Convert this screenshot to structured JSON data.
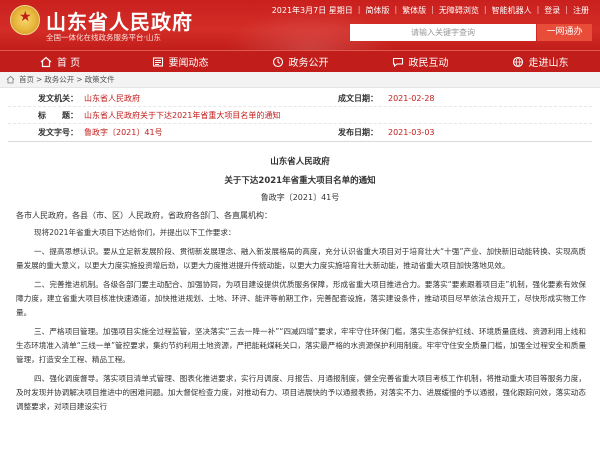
{
  "header": {
    "site_title": "山东省人民政府",
    "site_subtitle": "全国一体化在线政务服务平台·山东",
    "top_links": [
      "2021年3月7日 星期日",
      "简体版",
      "繁体版",
      "无障碍浏览",
      "智能机器人",
      "登录",
      "注册"
    ],
    "search_placeholder": "请输入关键字查询",
    "search_button": "一网通办"
  },
  "nav": [
    {
      "label": "首 页",
      "icon": "home-icon"
    },
    {
      "label": "要闻动态",
      "icon": "news-icon"
    },
    {
      "label": "政务公开",
      "icon": "open-gov-icon"
    },
    {
      "label": "政民互动",
      "icon": "interaction-icon"
    },
    {
      "label": "走进山东",
      "icon": "globe-icon"
    }
  ],
  "breadcrumb": [
    "首页",
    "政务公开",
    "政策文件"
  ],
  "meta": {
    "issuer_label": "发文机关：",
    "issuer": "山东省人民政府",
    "date_label": "成文日期：",
    "date": "2021-02-28",
    "title_label": "标　　题：",
    "title": "山东省人民政府关于下达2021年省重大项目名单的通知",
    "number_label": "发文字号：",
    "number": "鲁政字〔2021〕41号",
    "pub_label": "发布日期：",
    "pub_date": "2021-03-03"
  },
  "doc": {
    "org": "山东省人民政府",
    "title": "关于下达2021年省重大项目名单的通知",
    "number": "鲁政字〔2021〕41号",
    "salutation": "各市人民政府，各县（市、区）人民政府，省政府各部门、各直属机构：",
    "paragraphs": [
      "现将2021年省重大项目下达给你们，并提出以下工作要求：",
      "一、提高思想认识。要从立足新发展阶段、贯彻新发展理念、融入新发展格局的高度，充分认识省重大项目对于培育壮大“十强”产业、加快新旧动能转换、实现高质量发展的重大意义，以更大力度实施投资增后劲，以更大力度推进提升传统动能，以更大力度实施培育壮大新动能，推动省重大项目加快落地见效。",
      "二、完善推进机制。各级各部门要主动配合、加强协同，为项目建设提供优质服务保障，形成省重大项目推进合力。要落实“要素跟着项目走”机制，强化要素有效保障力度，建立省重大项目核准快速通道，加快推进规划、土地、环评、能评等前期工作，完善配套设施，落实建设条件，推动项目尽早依法合规开工，尽快形成实物工作量。",
      "三、严格项目管理。加强项目实施全过程监管，坚决落实“三去一降一补”“四减四增”要求，牢牢守住环保门槛，落实生态保护红线、环境质量底线、资源利用上线和生态环境准入清单“三线一单”管控要求，集约节约利用土地资源，严把能耗煤耗关口，落实最严格的水资源保护利用制度。牢牢守住安全质量门槛，加强全过程安全和质量管理，打造安全工程、精品工程。",
      "四、强化调度督导。落实项目清单式管理、图表化推进要求，实行月调度、月报告、月通报制度，健全完善省重大项目考核工作机制，将推动重大项目等服务力度，及时发现并协调解决项目推进中的困难问题。加大督促检查力度，对推动有力、项目进展快的予以通报表扬，对落实不力、进展缓慢的予以通报，强化跟踪问效，落实动态调整要求，对项目建设实行"
    ]
  },
  "colors": {
    "brand_red": "#c11d1a",
    "accent_orange": "#e84d3a"
  }
}
